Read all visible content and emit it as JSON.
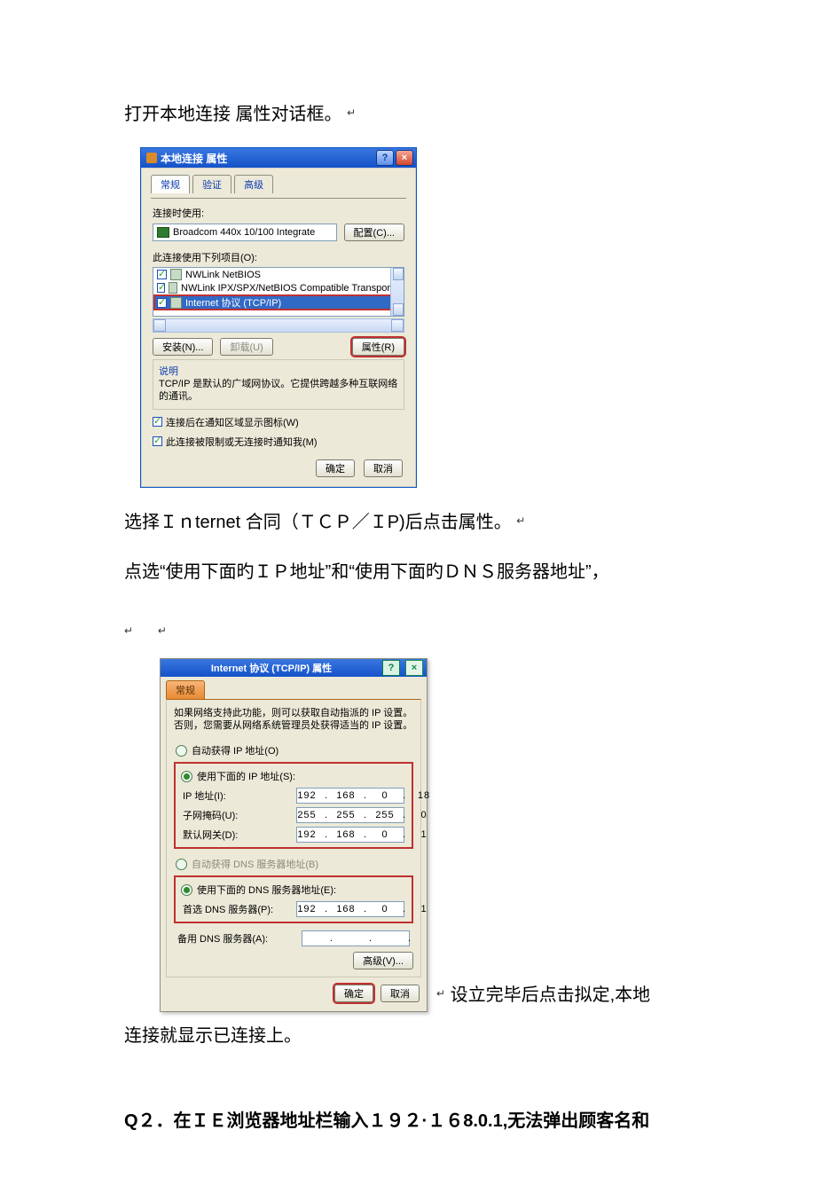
{
  "doc": {
    "p1": "打开本地连接 属性对话框。",
    "p2": "选择Ｉｎternet 合同（ＴＣＰ／ＩP)后点击属性。",
    "p3": "点选“使用下面旳ＩＰ地址”和“使用下面旳ＤＮＳ服务器地址”，",
    "p4a": "设立完毕后点击拟定,本地",
    "p4b": "连接就显示已连接上。",
    "q2": "Q２．在ＩＥ浏览器地址栏输入１９２·１６8.0.1,无法弹出顾客名和"
  },
  "dlg1": {
    "title": "本地连接 属性",
    "tab_general": "常规",
    "tab_auth": "验证",
    "tab_adv": "高级",
    "connect_using": "连接时使用:",
    "adapter": "Broadcom 440x 10/100 Integrate",
    "btn_config": "配置(C)...",
    "items_label": "此连接使用下列项目(O):",
    "item_nwlink_netbios": "NWLink NetBIOS",
    "item_nwlink_ipx": "NWLink IPX/SPX/NetBIOS Compatible Transpor…",
    "item_tcpip": "Internet 协议 (TCP/IP)",
    "btn_install": "安装(N)...",
    "btn_uninstall": "卸载(U)",
    "btn_props": "属性(R)",
    "desc_title": "说明",
    "desc_text": "TCP/IP 是默认的广域网协议。它提供跨越多种互联网络的通讯。",
    "chk_tray": "连接后在通知区域显示图标(W)",
    "chk_limited": "此连接被限制或无连接时通知我(M)",
    "btn_ok": "确定",
    "btn_cancel": "取消"
  },
  "dlg2": {
    "title": "Internet 协议 (TCP/IP) 属性",
    "tab_general": "常规",
    "info": "如果网络支持此功能，则可以获取自动指派的 IP 设置。否则，您需要从网络系统管理员处获得适当的 IP 设置。",
    "r_auto_ip": "自动获得 IP 地址(O)",
    "r_use_ip": "使用下面的 IP 地址(S):",
    "lbl_ip": "IP 地址(I):",
    "lbl_mask": "子网掩码(U):",
    "lbl_gw": "默认网关(D):",
    "r_auto_dns": "自动获得 DNS 服务器地址(B)",
    "r_use_dns": "使用下面的 DNS 服务器地址(E):",
    "lbl_dns1": "首选 DNS 服务器(P):",
    "lbl_dns2": "备用 DNS 服务器(A):",
    "btn_adv": "高级(V)...",
    "btn_ok": "确定",
    "btn_cancel": "取消",
    "ip": [
      "192",
      "168",
      "0",
      "18"
    ],
    "mask": [
      "255",
      "255",
      "255",
      "0"
    ],
    "gw": [
      "192",
      "168",
      "0",
      "1"
    ],
    "dns1": [
      "192",
      "168",
      "0",
      "1"
    ],
    "dns2": [
      "",
      "",
      "",
      ""
    ]
  }
}
